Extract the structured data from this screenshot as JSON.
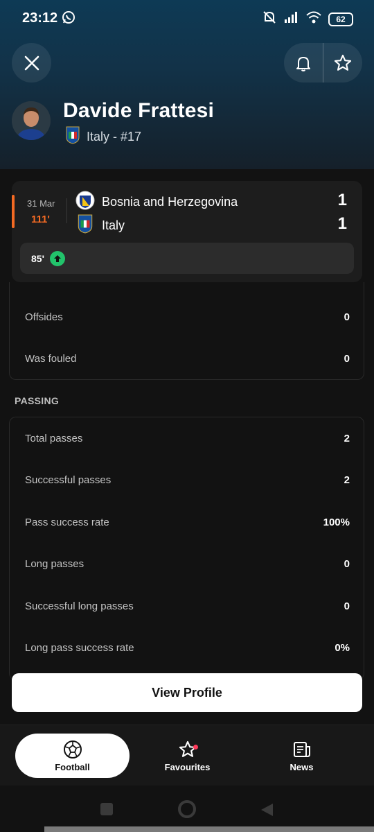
{
  "status": {
    "time": "23:12",
    "battery": "62"
  },
  "player": {
    "name": "Davide Frattesi",
    "team_line": "Italy - #17"
  },
  "match": {
    "date": "31 Mar",
    "minute": "111'",
    "home": {
      "name": "Bosnia and Herzegovina",
      "score": "1"
    },
    "away": {
      "name": "Italy",
      "score": "1"
    },
    "event": {
      "minute": "85'",
      "icon": "sub-in-arrow-up-icon"
    }
  },
  "stats_top": [
    {
      "label": "Offsides",
      "value": "0"
    },
    {
      "label": "Was fouled",
      "value": "0"
    }
  ],
  "passing": {
    "title": "PASSING",
    "rows": [
      {
        "label": "Total passes",
        "value": "2"
      },
      {
        "label": "Successful passes",
        "value": "2"
      },
      {
        "label": "Pass success rate",
        "value": "100%"
      },
      {
        "label": "Long passes",
        "value": "0"
      },
      {
        "label": "Successful long passes",
        "value": "0"
      },
      {
        "label": "Long pass success rate",
        "value": "0%"
      }
    ]
  },
  "view_profile_label": "View Profile",
  "nav": [
    {
      "label": "Football",
      "icon": "football-icon"
    },
    {
      "label": "Favourites",
      "icon": "star-icon"
    },
    {
      "label": "News",
      "icon": "news-icon"
    }
  ],
  "colors": {
    "accent": "#f46a23",
    "sub_green": "#22c36b"
  }
}
